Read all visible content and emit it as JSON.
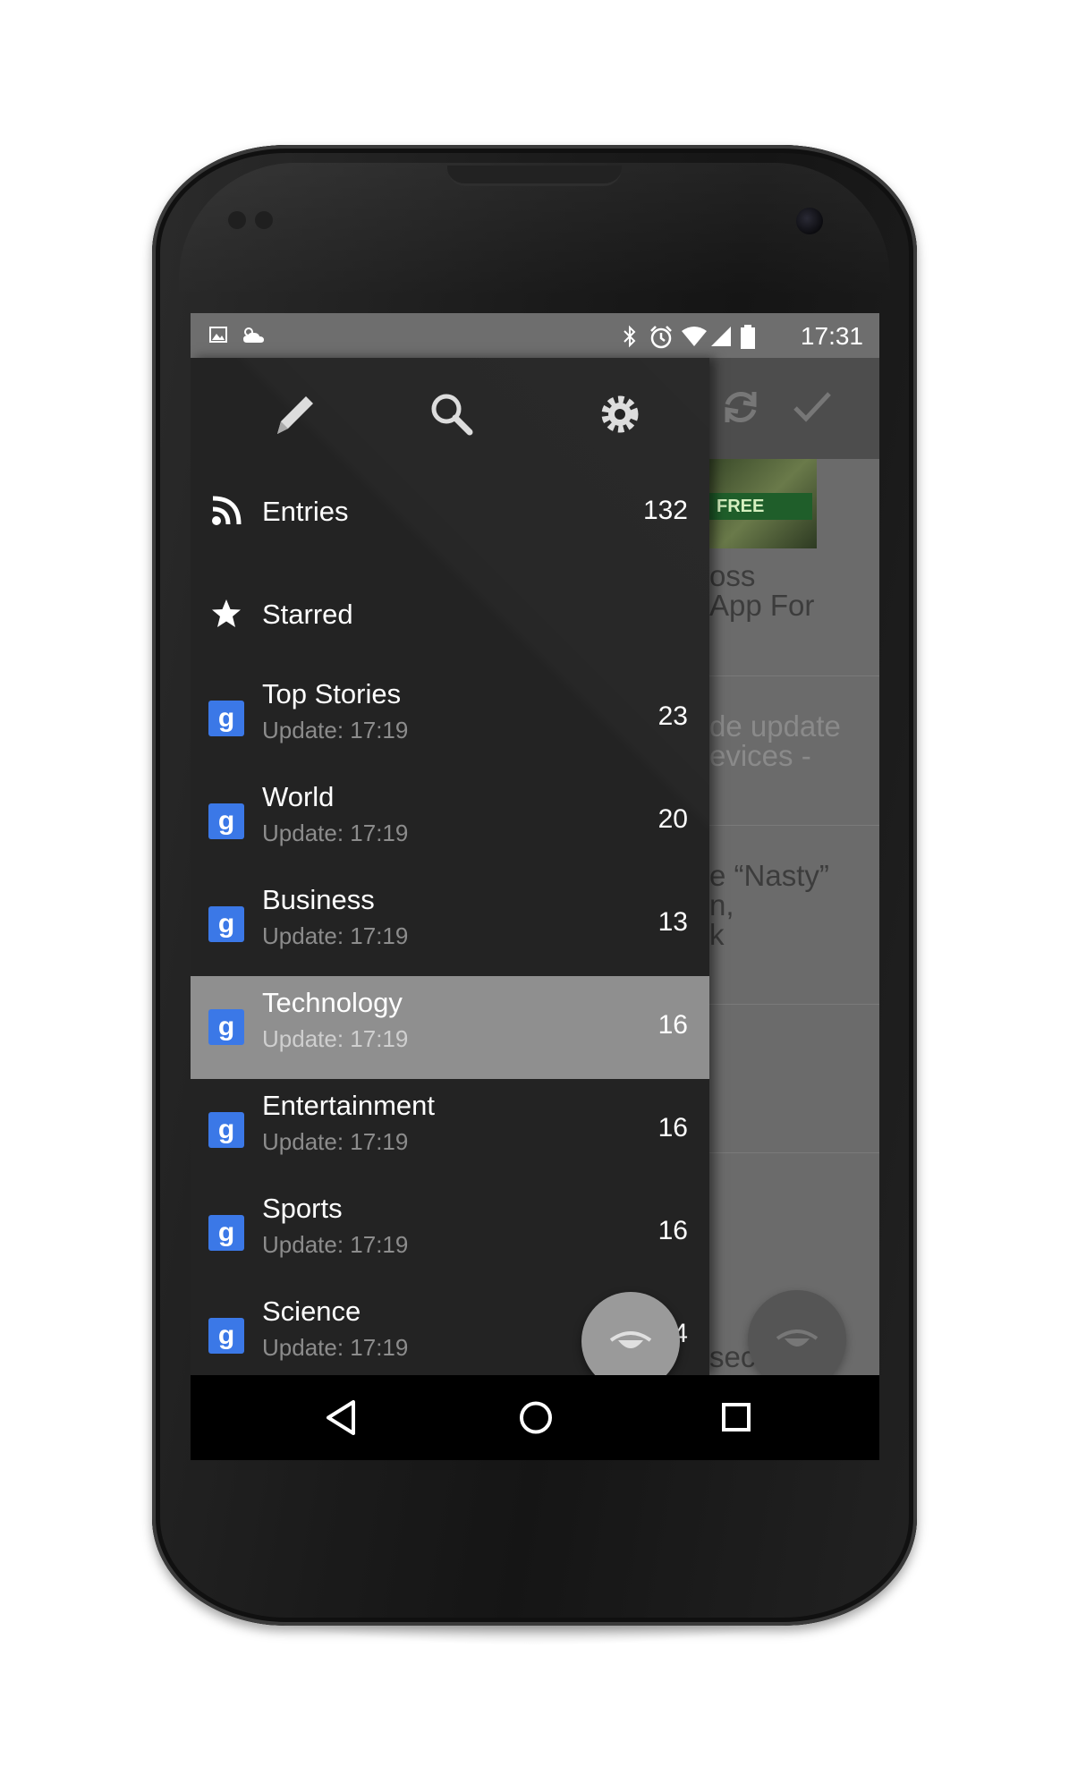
{
  "status_bar": {
    "time": "17:31",
    "left_icons": [
      "image-icon",
      "weather-icon"
    ],
    "right_icons": [
      "bluetooth-icon",
      "alarm-icon",
      "wifi-icon",
      "signal-icon",
      "battery-icon"
    ]
  },
  "drawer": {
    "actions": [
      {
        "name": "edit-icon",
        "glyph": "✎"
      },
      {
        "name": "search-icon",
        "glyph": "⚲"
      },
      {
        "name": "settings-icon",
        "glyph": "⚙"
      }
    ],
    "items": [
      {
        "title": "Entries",
        "count": "132",
        "icon": "rss-icon"
      },
      {
        "title": "Starred",
        "count": "",
        "icon": "star-icon"
      },
      {
        "title": "Top Stories",
        "subtitle": "Update: 17:19",
        "count": "23",
        "icon": "google-news-icon"
      },
      {
        "title": "World",
        "subtitle": "Update: 17:19",
        "count": "20",
        "icon": "google-news-icon"
      },
      {
        "title": "Business",
        "subtitle": "Update: 17:19",
        "count": "13",
        "icon": "google-news-icon"
      },
      {
        "title": "Technology",
        "subtitle": "Update: 17:19",
        "count": "16",
        "icon": "google-news-icon",
        "selected": true
      },
      {
        "title": "Entertainment",
        "subtitle": "Update: 17:19",
        "count": "16",
        "icon": "google-news-icon"
      },
      {
        "title": "Sports",
        "subtitle": "Update: 17:19",
        "count": "16",
        "icon": "google-news-icon"
      },
      {
        "title": "Science",
        "subtitle": "Update: 17:19",
        "count": "14",
        "icon": "google-news-icon"
      }
    ],
    "fab_icon": "eye-icon"
  },
  "background_list": {
    "thumb_badge": "FREE",
    "lines": [
      "oss",
      "App For",
      "de update",
      "evices -",
      "e “Nasty”",
      "n,",
      "k",
      "second-"
    ],
    "toolbar_icons": [
      "refresh-icon",
      "check-icon"
    ]
  },
  "colors": {
    "status_bar": "#6e6e6e",
    "drawer": "#232323",
    "selected_row": "#8f8f8f",
    "feed_icon": "#3b78e7",
    "navbar": "#000000"
  }
}
